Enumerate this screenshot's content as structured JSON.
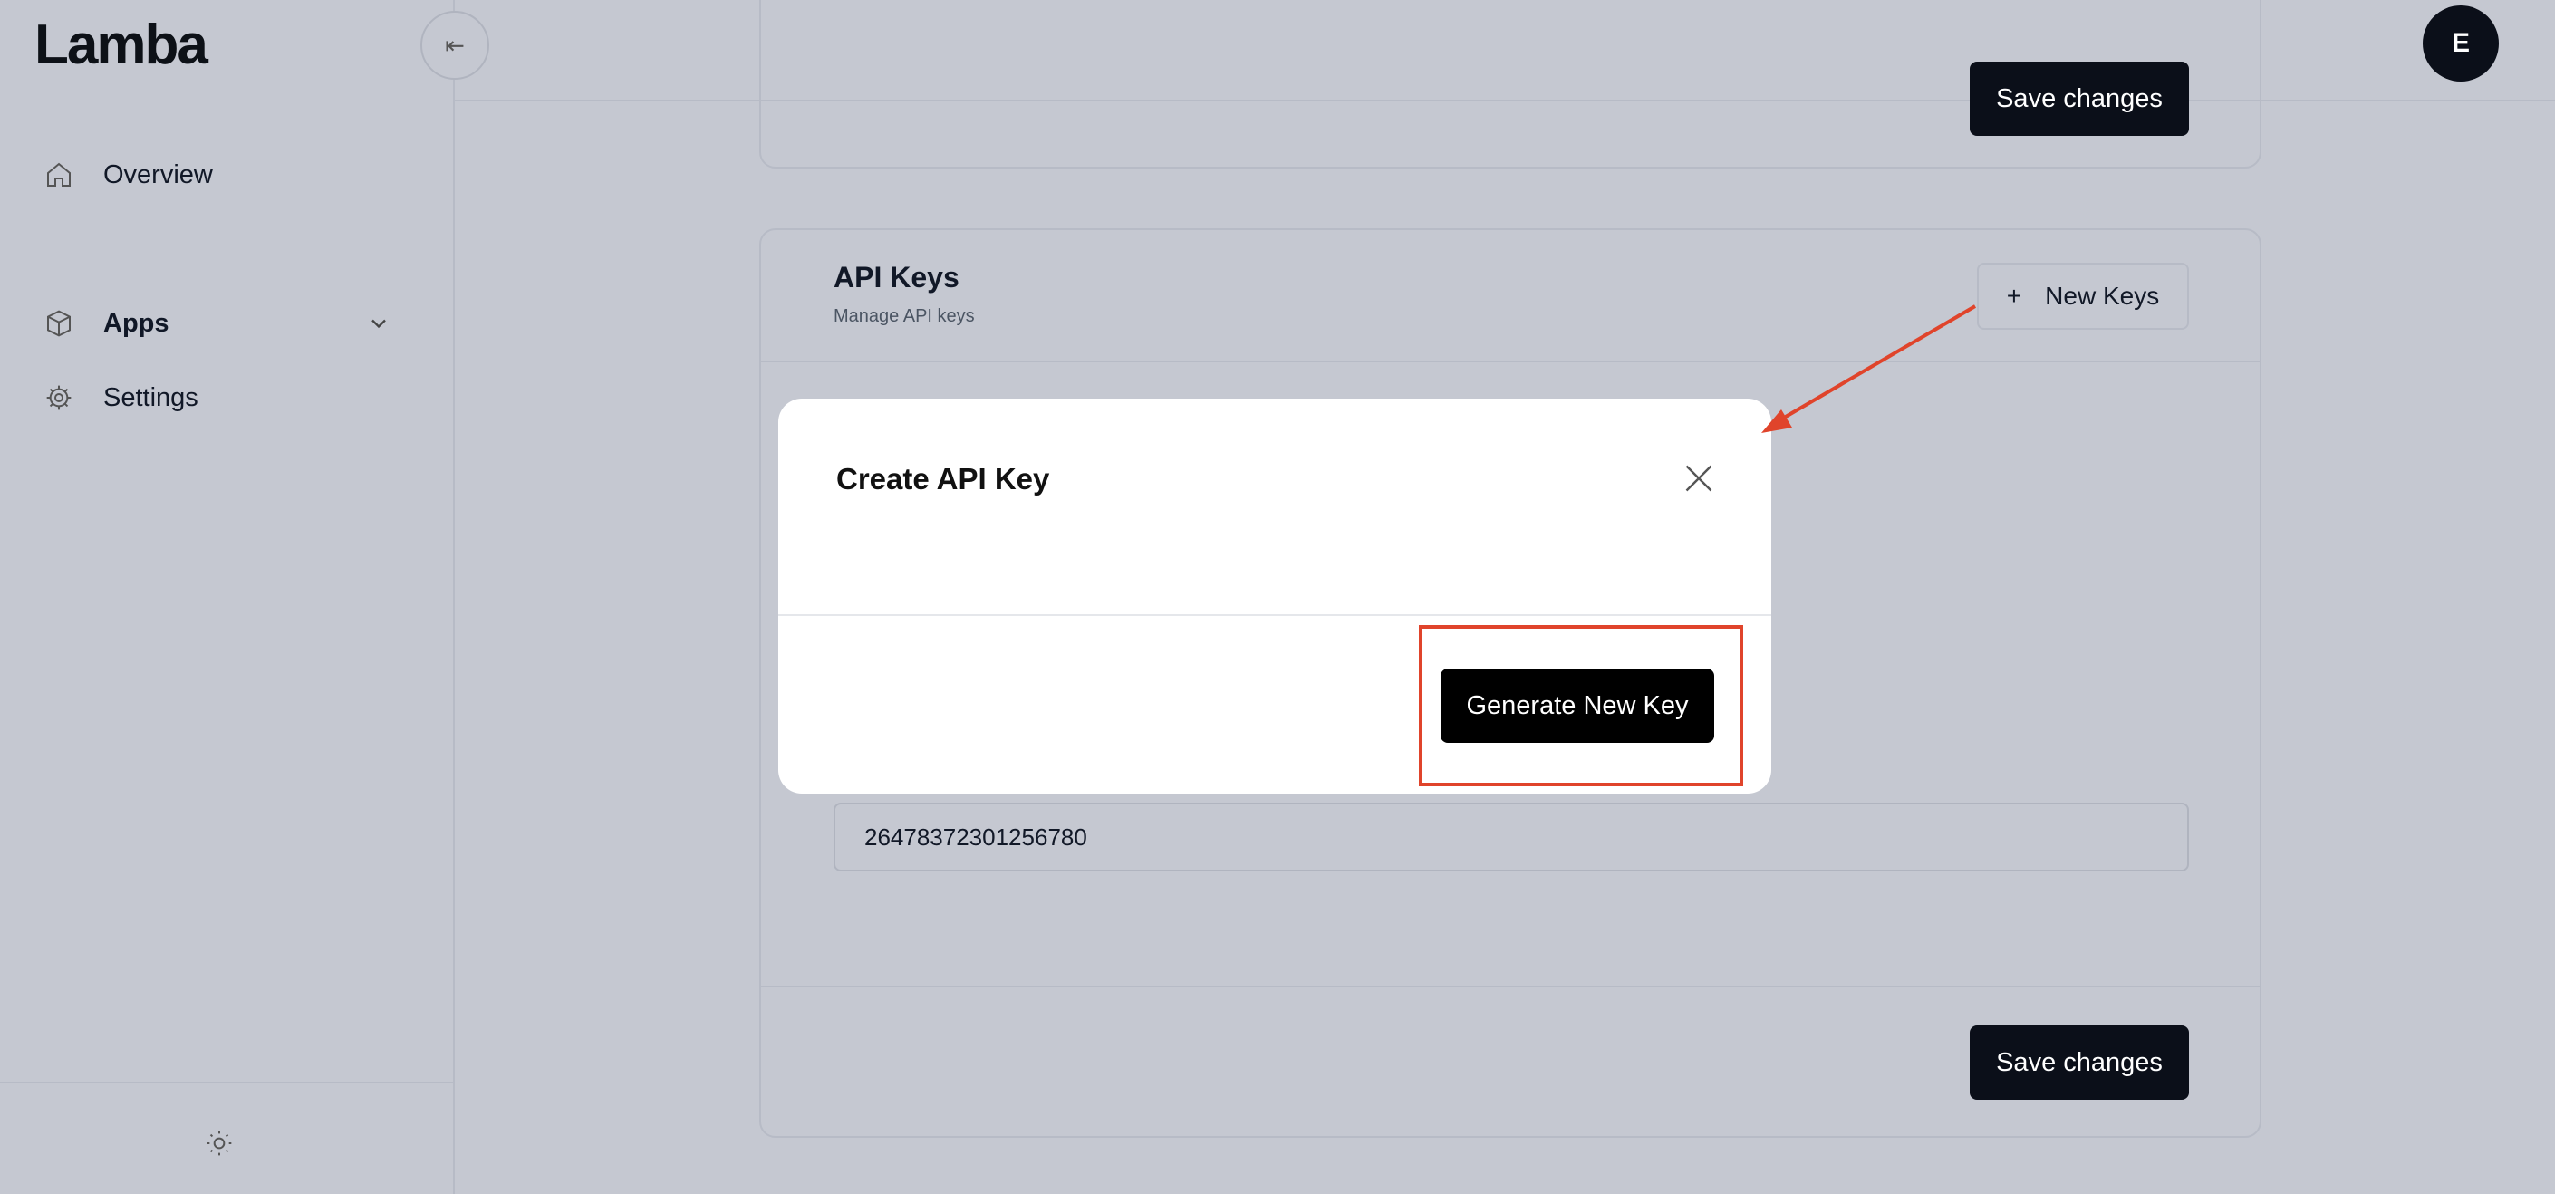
{
  "logo": {
    "text": "Lamba"
  },
  "sidebar": {
    "items": [
      {
        "label": "Overview"
      },
      {
        "label": "Apps"
      },
      {
        "label": "Settings"
      }
    ]
  },
  "header": {
    "collapse_glyph": "⇤",
    "avatar_initial": "E"
  },
  "top_card": {
    "save_label": "Save changes"
  },
  "api_card": {
    "title": "API Keys",
    "subtitle": "Manage API keys",
    "new_keys_label": "New Keys",
    "key_value": "26478372301256780",
    "save_label": "Save changes"
  },
  "modal": {
    "title": "Create API Key",
    "generate_label": "Generate New Key"
  },
  "annotation": {
    "color": "#e0442b"
  }
}
